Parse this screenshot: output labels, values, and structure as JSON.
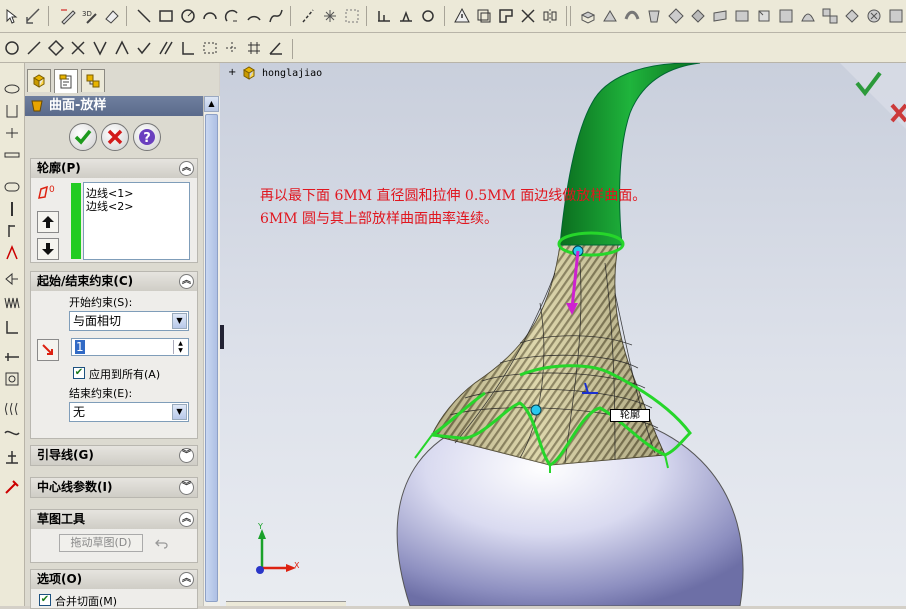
{
  "property_manager": {
    "title": "曲面-放样",
    "tabs": [
      "feature-manager",
      "property-manager",
      "configuration-manager"
    ],
    "profile_group": {
      "title": "轮廓(P)",
      "items": [
        "边线<1>",
        "边线<2>"
      ]
    },
    "constraints_group": {
      "title": "起始/结束约束(C)",
      "start_label": "开始约束(S):",
      "start_value": "与面相切",
      "tangent_value": "1",
      "apply_all_label": "应用到所有(A)",
      "end_label": "结束约束(E):",
      "end_value": "无"
    },
    "guide_group": {
      "title": "引导线(G)"
    },
    "centerline_group": {
      "title": "中心线参数(I)"
    },
    "sketch_tools_group": {
      "title": "草图工具",
      "drag_sketch": "拖动草图(D)"
    },
    "options_group": {
      "title": "选项(O)",
      "merge_faces": "合并切面(M)"
    }
  },
  "viewport": {
    "tree_root": "honglajiao",
    "note_line1": "再以最下面 6MM 直径圆和拉伸 0.5MM 面边线做放样曲面。",
    "note_line2": "6MM 圆与其上部放样曲面曲率连续。",
    "callout": "轮廓",
    "triad": {
      "x": "X",
      "y": "Y"
    }
  },
  "colors": {
    "green_stem": "#129a2e",
    "accent_red": "#e0161f",
    "title_bar": "#5a6a8b"
  }
}
